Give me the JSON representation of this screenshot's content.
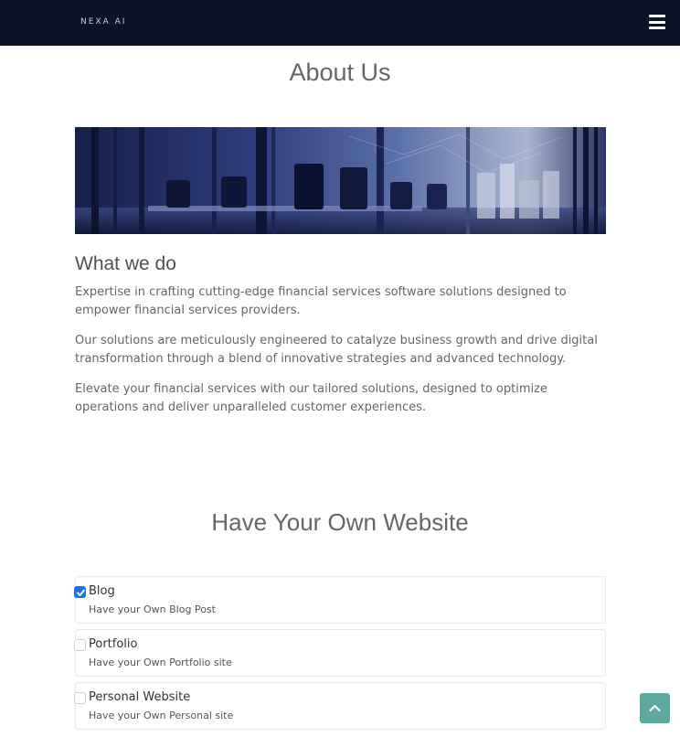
{
  "header": {
    "logo_text": "NEXA AI",
    "menu_icon": "hamburger-menu-icon",
    "background": "#0b1327"
  },
  "about": {
    "title": "About Us",
    "banner": "office-glass-meeting-room-image",
    "heading": "What we do",
    "paragraphs": [
      "Expertise in crafting cutting-edge financial services software solutions designed to empower financial services providers.",
      "Our solutions are meticulously engineered to catalyze business growth and drive digital transformation through a blend of innovative strategies and advanced technology.",
      "Elevate your financial services with our tailored solutions, designed to optimize operations and deliver unparalleled customer experiences."
    ]
  },
  "website": {
    "title": "Have Your Own Website",
    "options": [
      {
        "label": "Blog",
        "description": "Have your Own Blog Post",
        "checked": true
      },
      {
        "label": "Portfolio",
        "description": "Have your Own Portfolio site",
        "checked": false
      },
      {
        "label": "Personal Website",
        "description": "Have your Own Personal site",
        "checked": false
      }
    ]
  },
  "scroll_top": {
    "icon": "chevron-up-icon",
    "color": "#5fa8a0"
  },
  "colors": {
    "accent": "#1a73e8"
  }
}
